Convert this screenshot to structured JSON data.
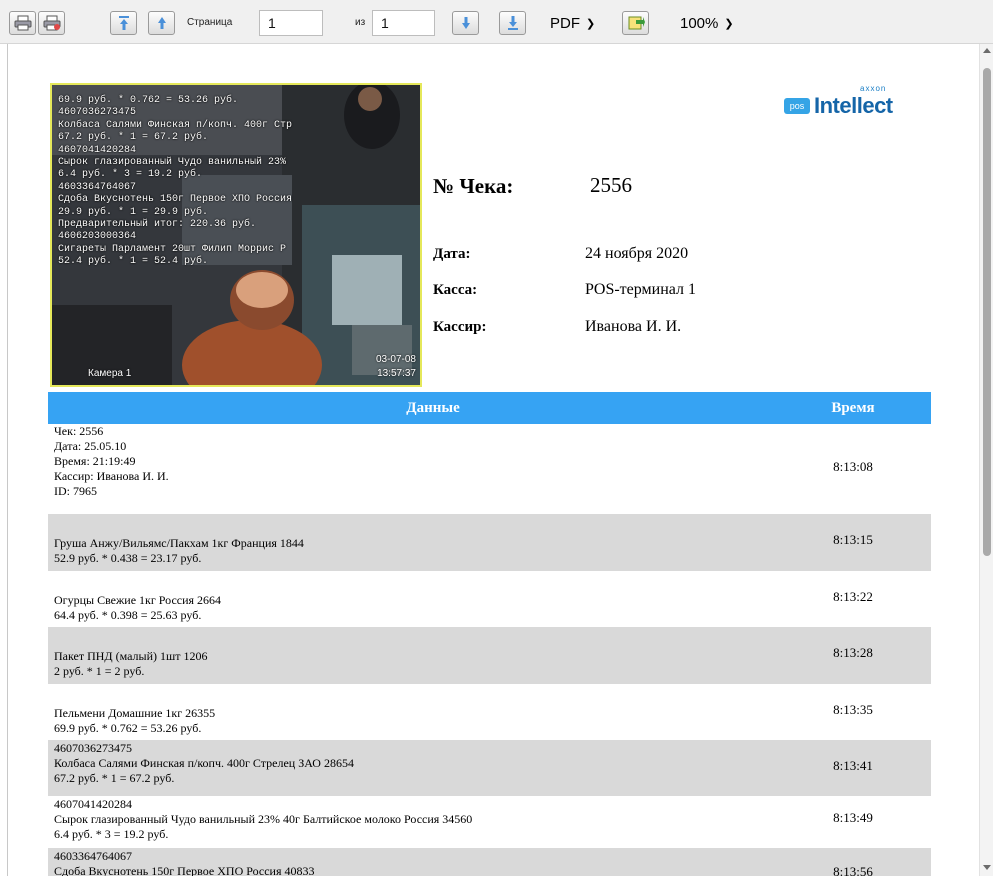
{
  "toolbar": {
    "page_label": "Страница",
    "page_value": "1",
    "of_label": "из",
    "total_pages": "1",
    "format_selected": "PDF",
    "zoom_selected": "100%"
  },
  "camera": {
    "overlay_lines": [
      "69.9 руб. * 0.762 = 53.26 руб.",
      "4607036273475",
      "Колбаса Салями Финская п/копч. 400г Стр",
      "67.2 руб. * 1 = 67.2 руб.",
      "4607041420284",
      "Сырок глазированный Чудо ванильный 23%",
      "6.4 руб. * 3 = 19.2 руб.",
      "4603364764067",
      "Сдоба Вкуснотень 150г Первое ХПО Россия",
      "29.9 руб. * 1 = 29.9 руб.",
      "Предварительный итог: 220.36 руб.",
      "4606203000364",
      "Сигареты Парламент 20шт Филип Моррис Р",
      "52.4 руб. * 1 = 52.4 руб."
    ],
    "camera_name": "Камера 1",
    "date": "03-07-08",
    "time": "13:57:37"
  },
  "logo": {
    "small_text": "axxon",
    "badge_text": "pos",
    "main_text": "Intellect"
  },
  "receipt": {
    "number_label": "№ Чека:",
    "number_value": "2556",
    "date_label": "Дата:",
    "date_value": "24 ноября 2020",
    "register_label": "Касса:",
    "register_value": "POS-терминал 1",
    "cashier_label": "Кассир:",
    "cashier_value": "Иванова И. И."
  },
  "table": {
    "header_data": "Данные",
    "header_time": "Время",
    "rows": [
      {
        "lines": [
          "Чек: 2556",
          "Дата: 25.05.10",
          "Время: 21:19:49",
          "Кассир: Иванова И. И.",
          "ID: 7965"
        ],
        "time": "8:13:08"
      },
      {
        "lines": [
          "Груша Анжу/Вильямс/Пакхам 1кг Франция 1844",
          "52.9 руб. * 0.438 = 23.17 руб."
        ],
        "time": "8:13:15"
      },
      {
        "lines": [
          "Огурцы Свежие 1кг Россия 2664",
          "64.4 руб. * 0.398 = 25.63 руб."
        ],
        "time": "8:13:22"
      },
      {
        "lines": [
          "Пакет ПНД (малый) 1шт 1206",
          "2 руб. * 1 = 2 руб."
        ],
        "time": "8:13:28"
      },
      {
        "lines": [
          "Пельмени Домашние 1кг 26355",
          "69.9 руб. * 0.762 = 53.26 руб."
        ],
        "time": "8:13:35"
      },
      {
        "lines": [
          "4607036273475",
          "Колбаса Салями Финская п/копч. 400г Стрелец ЗАО 28654",
          "67.2 руб. * 1 = 67.2 руб."
        ],
        "time": "8:13:41"
      },
      {
        "lines": [
          "4607041420284",
          "Сырок глазированный Чудо ванильный 23% 40г Балтийское молоко Россия 34560",
          "6.4 руб. * 3 = 19.2 руб."
        ],
        "time": "8:13:49"
      },
      {
        "lines": [
          "4603364764067",
          "Сдоба Вкуснотень 150г Первое ХПО Россия 40833"
        ],
        "time": "8:13:56"
      }
    ]
  },
  "colors": {
    "table_header": "#36a3f3",
    "row_gray": "#d9d9d9",
    "camera_border": "#e5e85a"
  }
}
